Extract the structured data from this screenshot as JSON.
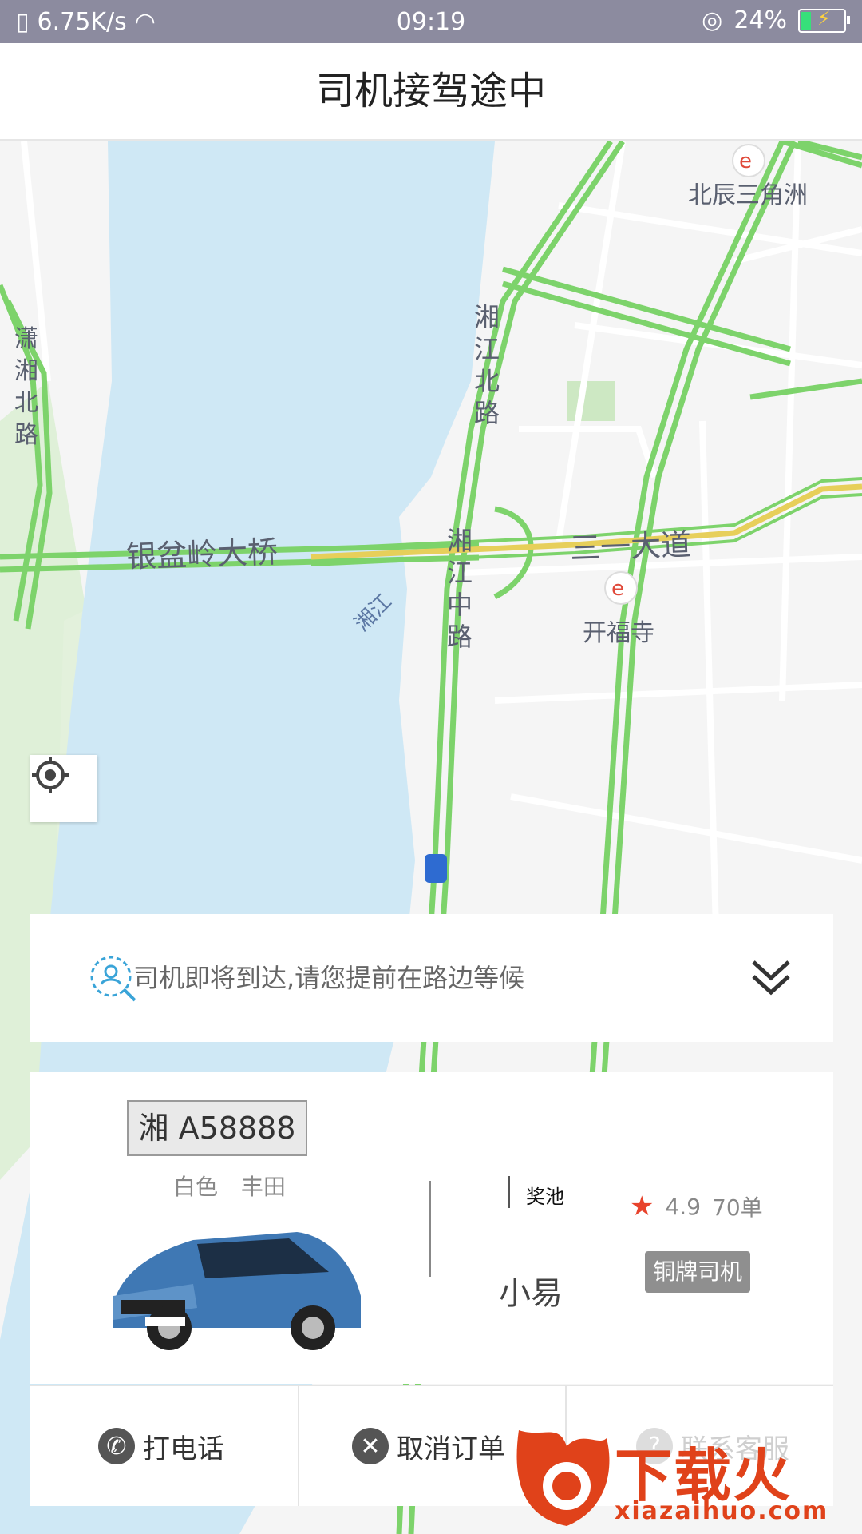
{
  "status_bar": {
    "network_speed": "6.75K/s",
    "time": "09:19",
    "battery": "24%",
    "battery_level": 0.24
  },
  "header": {
    "title": "司机接驾途中"
  },
  "map": {
    "labels": {
      "beichen": "北辰三角洲",
      "xiaoxiang": "潇湘北路",
      "xiangjiang_north": "湘江北路",
      "yinpenling": "银盆岭大桥",
      "sanyi": "三一大道",
      "xiangjiang_mid": "湘江中路",
      "xiangjiang": "湘江",
      "kaifusi": "开福寺"
    }
  },
  "notice": {
    "message": "司机即将到达,请您提前在路边等候"
  },
  "driver_card": {
    "plate": "湘 A58888",
    "car_color": "白色",
    "car_brand": "丰田",
    "pool_label": "奖池",
    "driver_name": "小易",
    "rating": "4.9",
    "orders": "70单",
    "badge": "铜牌司机"
  },
  "actions": {
    "call": "打电话",
    "cancel": "取消订单",
    "service": "联系客服"
  },
  "watermark": {
    "brand": "下载火",
    "url": "xiazaihuo.com"
  },
  "colors": {
    "status_bar": "#8c8b9f",
    "river": "#cfe8f5",
    "road_green": "#7dd36b",
    "road_yellow": "#e7cf5a",
    "star": "#e8432c",
    "watermark": "#e0421a"
  }
}
